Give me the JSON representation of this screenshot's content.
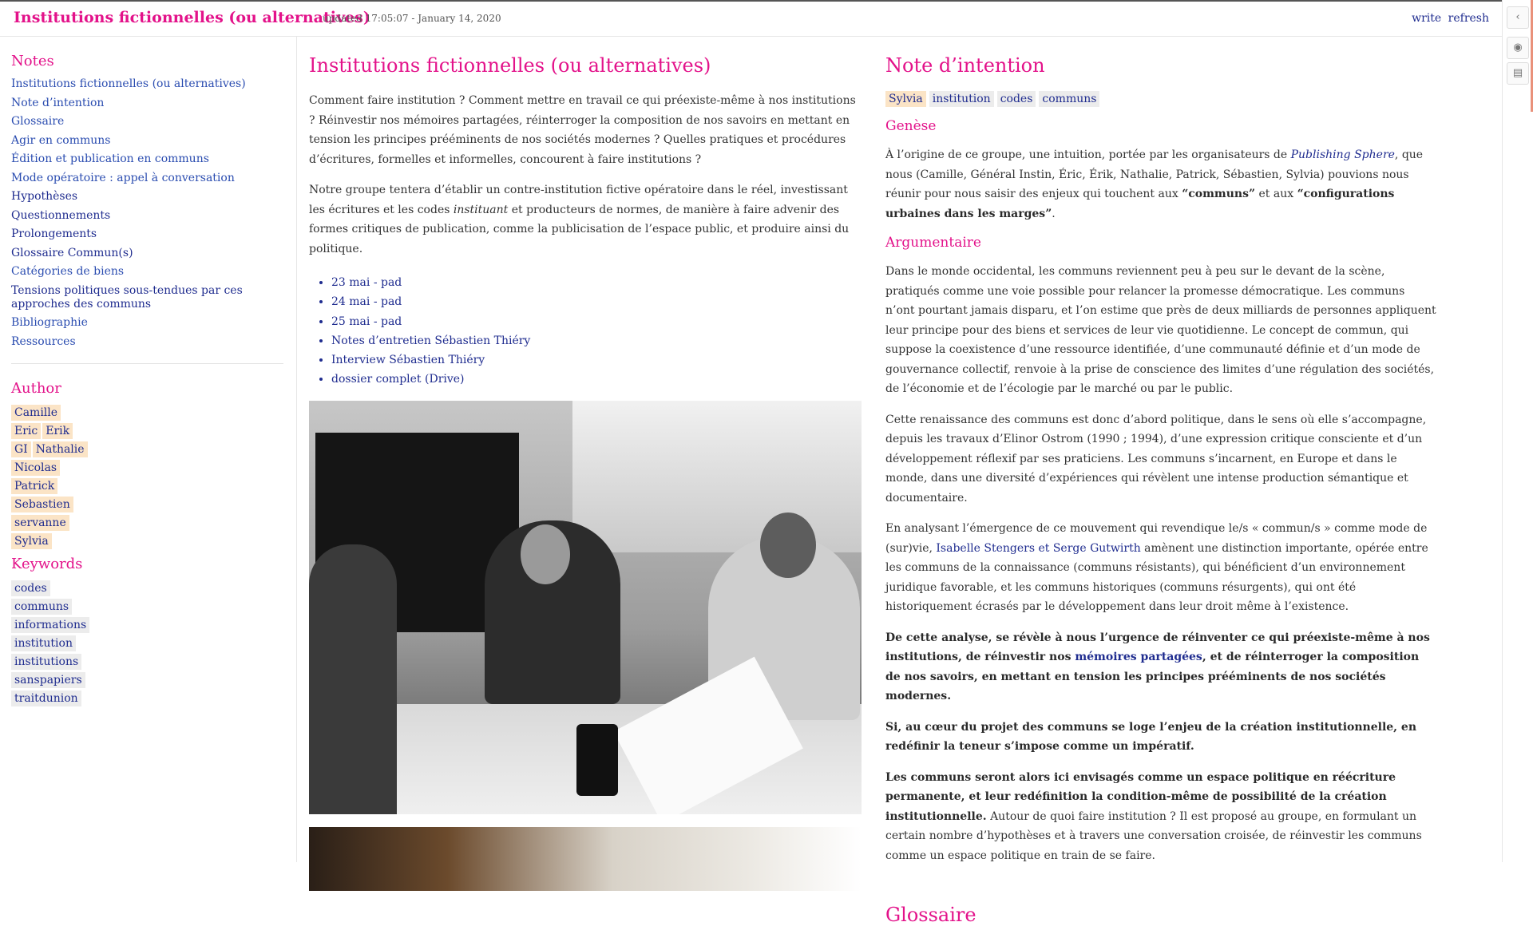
{
  "header": {
    "site_title": "Institutions fictionnelles (ou alternatives)",
    "updated": "updated 17:05:07 - January 14, 2020",
    "write_label": "write",
    "refresh_label": "refresh"
  },
  "dock": {
    "collapse_icon": "chevron-left-icon",
    "view_icon": "eye-icon",
    "notes_icon": "document-icon",
    "collapse_glyph": "‹",
    "view_glyph": "◉",
    "notes_glyph": "▤"
  },
  "sidebar": {
    "notes_heading": "Notes",
    "notes": [
      "Institutions fictionnelles (ou alternatives)",
      "Note d’intention",
      "Glossaire",
      "Agir en communs",
      "Édition et publication en communs",
      "Mode opératoire : appel à conversation",
      "Hypothèses",
      "Questionnements",
      "Prolongements",
      "Glossaire Commun(s)",
      "Catégories de biens",
      "Tensions politiques sous-tendues par ces approches des communs",
      "Bibliographie",
      "Ressources"
    ],
    "author_heading": "Author",
    "authors": {
      "a0": "Camille",
      "a1": "Eric",
      "a2": "Erik",
      "a3": "GI",
      "a4": "Nathalie",
      "a5": "Nicolas",
      "a6": "Patrick",
      "a7": "Sebastien",
      "a8": "servanne",
      "a9": "Sylvia"
    },
    "keywords_heading": "Keywords",
    "keywords": [
      "codes",
      "communs",
      "informations",
      "institution",
      "institutions",
      "sanspapiers",
      "traitdunion"
    ]
  },
  "main": {
    "title": "Institutions fictionnelles (ou alternatives)",
    "intro_p1": "Comment faire institution ? Comment mettre en travail ce qui préexiste-même à nos institutions ? Réinvestir nos mémoires partagées, réinterroger la composition de nos savoirs en mettant en tension les principes prééminents de nos sociétés modernes ? Quelles pratiques et procédures d’écritures, formelles et informelles, concourent à faire institutions ?",
    "intro_p2_a": "Notre groupe tentera d’établir un contre-institution fictive opératoire dans le réel, investissant les écritures et les codes ",
    "intro_p2_em": "instituant",
    "intro_p2_b": " et producteurs de normes, de manière à faire advenir des formes critiques de publication, comme la publicisation de l’espace public, et produire ainsi du politique.",
    "links": [
      "23 mai - pad",
      "24 mai - pad",
      "25 mai - pad",
      "Notes d’entretien Sébastien Thiéry",
      "Interview Sébastien Thiéry",
      "dossier complet (Drive)"
    ]
  },
  "note": {
    "title": "Note d’intention",
    "tags": [
      "Sylvia",
      "institution",
      "codes",
      "communs"
    ],
    "genese_heading": "Genèse",
    "genese_a": "À l’origine de ce groupe, une intuition, portée par les organisateurs de ",
    "genese_em": "Publishing Sphere",
    "genese_b": ", que nous (Camille, Général Instin, Éric, Érik, Nathalie, Patrick, Sébastien, Sylvia) pouvions nous réunir pour nous saisir des enjeux qui touchent aux ",
    "genese_strong1": "“communs”",
    "genese_c": " et aux ",
    "genese_strong2": "“configurations urbaines dans les marges”",
    "genese_d": ".",
    "argumentaire_heading": "Argumentaire",
    "arg_p1": "Dans le monde occidental, les communs reviennent peu à peu sur le devant de la scène, pratiqués comme une voie possible pour relancer la promesse démocratique. Les communs n’ont pourtant jamais disparu, et l’on estime que près de deux milliards de personnes appliquent leur principe pour des biens et services de leur vie quotidienne. Le concept de commun, qui suppose la coexistence d’une ressource identifiée, d’une communauté définie et d’un mode de gouvernance collectif, renvoie à la prise de conscience des limites d’une régulation des sociétés, de l’économie et de l’écologie par le marché ou par le public.",
    "arg_p2": "Cette renaissance des communs est donc d’abord politique, dans le sens où elle s’accompagne, depuis les travaux d’Elinor Ostrom (1990 ; 1994), d’une expression critique consciente et d’un développement réflexif par ses praticiens. Les communs s’incarnent, en Europe et dans le monde, dans une diversité d’expériences qui révèlent une intense production sémantique et documentaire.",
    "arg_p3_a": "En analysant l’émergence de ce mouvement qui revendique le/s « commun/s » comme mode de (sur)vie, ",
    "arg_p3_link": "Isabelle Stengers et Serge Gutwirth",
    "arg_p3_b": " amènent une distinction importante, opérée entre les communs de la connaissance (communs résistants), qui bénéficient d’un environnement juridique favorable, et les communs historiques (communs résurgents), qui ont été historiquement écrasés par le développement dans leur droit même à l’existence.",
    "arg_p4_a": "De cette analyse, se révèle à nous l’urgence de réinventer ce qui préexiste-même à nos institutions, de réinvestir nos ",
    "arg_p4_link": "mémoires partagées",
    "arg_p4_b": ", et de réinterroger la composition de nos savoirs, en mettant en tension les principes prééminents de nos sociétés modernes.",
    "arg_p5": "Si, au cœur du projet des communs se loge l’enjeu de la création institutionnelle, en redéfinir la teneur s’impose comme un impératif.",
    "arg_p6_strong": "Les communs seront alors ici envisagés comme un espace politique en réécriture permanente, et leur redéfinition la condition-même de possibilité de la création institutionnelle.",
    "arg_p6_rest": " Autour de quoi faire institution ? Il est proposé au groupe, en formulant un certain nombre d’hypothèses et à travers une conversation croisée, de réinvestir les communs comme un espace politique en train de se faire.",
    "next_heading": "Glossaire"
  }
}
